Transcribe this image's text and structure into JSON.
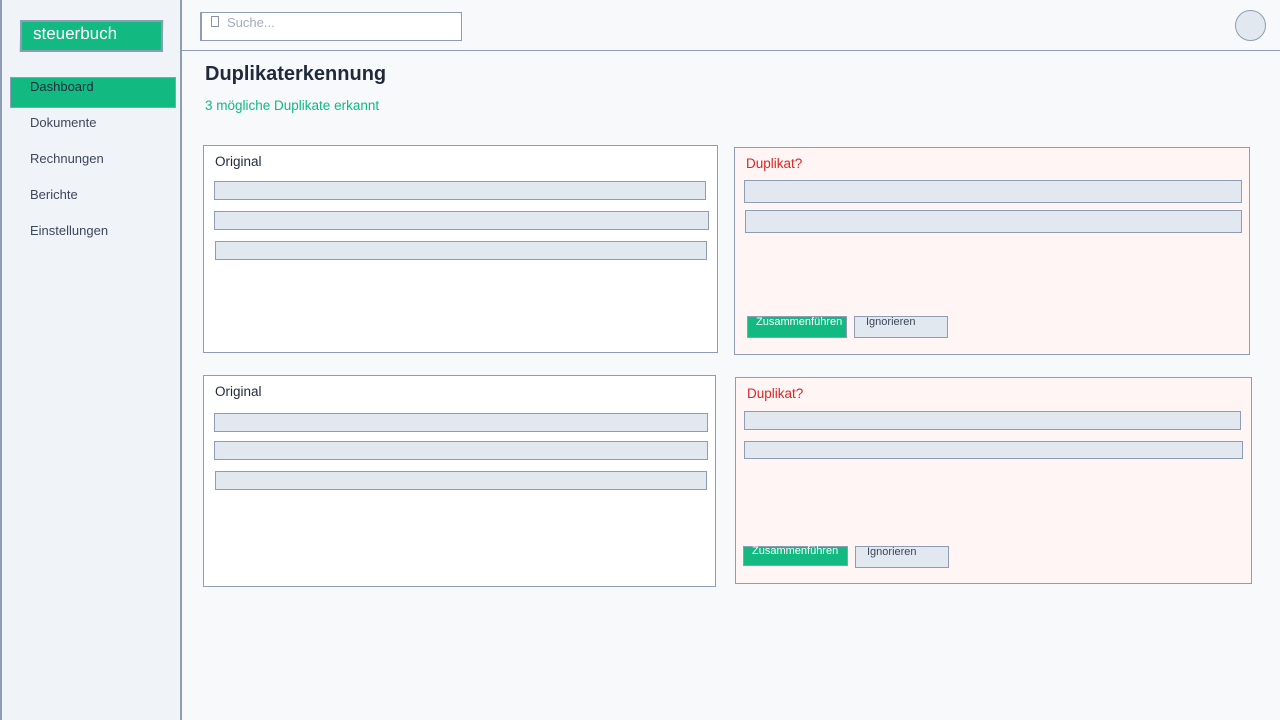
{
  "brand": {
    "name": "steuerbuch",
    "accent": "#12b981"
  },
  "sidebar": {
    "items": [
      {
        "label": "Dashboard",
        "active": true
      },
      {
        "label": "Dokumente",
        "active": false
      },
      {
        "label": "Rechnungen",
        "active": false
      },
      {
        "label": "Berichte",
        "active": false
      },
      {
        "label": "Einstellungen",
        "active": false
      }
    ]
  },
  "header": {
    "search_placeholder": "Suche...",
    "search_icon": "search-icon",
    "avatar_icon": "user-avatar"
  },
  "main": {
    "title": "Duplikaterkennung",
    "subtitle": "3 mögliche Duplikate erkannt",
    "pairs": [
      {
        "original_title": "Original",
        "duplicate_title": "Duplikat?",
        "merge_label": "Zusammenführen",
        "ignore_label": "Ignorieren"
      },
      {
        "original_title": "Original",
        "duplicate_title": "Duplikat?",
        "merge_label": "Zusammenführen",
        "ignore_label": "Ignorieren"
      }
    ]
  },
  "colors": {
    "accent": "#12b981",
    "danger": "#dc2626",
    "duplicate_bg": "#fff5f5",
    "placeholder_bar": "#e2e8f0"
  }
}
